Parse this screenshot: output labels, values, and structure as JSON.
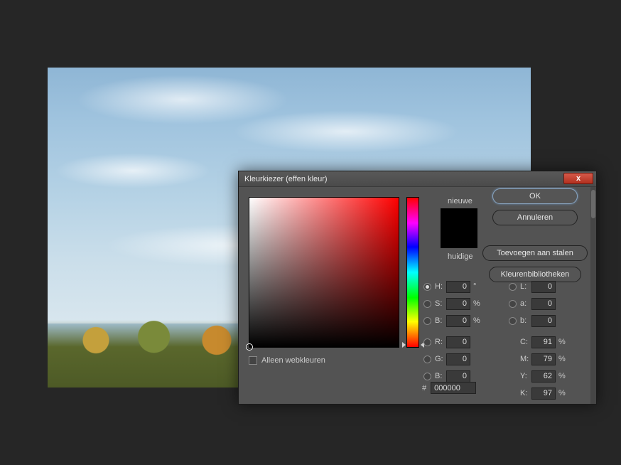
{
  "canvas": {
    "alt": "landscape-photo"
  },
  "dialog": {
    "title": "Kleurkiezer (effen kleur)",
    "close_icon": "x",
    "labels": {
      "new": "nieuwe",
      "current": "huidige",
      "web_only": "Alleen webkleuren",
      "hash": "#"
    },
    "buttons": {
      "ok": "OK",
      "cancel": "Annuleren",
      "add_swatch": "Toevoegen aan stalen",
      "libraries": "Kleurenbibliotheken"
    },
    "hsb": {
      "h_label": "H:",
      "h_value": "0",
      "h_unit": "°",
      "s_label": "S:",
      "s_value": "0",
      "s_unit": "%",
      "b_label": "B:",
      "b_value": "0",
      "b_unit": "%"
    },
    "rgb": {
      "r_label": "R:",
      "r_value": "0",
      "g_label": "G:",
      "g_value": "0",
      "b_label": "B:",
      "b_value": "0"
    },
    "lab": {
      "l_label": "L:",
      "l_value": "0",
      "a_label": "a:",
      "a_value": "0",
      "b_label": "b:",
      "b_value": "0"
    },
    "cmyk": {
      "c_label": "C:",
      "c_value": "91",
      "c_unit": "%",
      "m_label": "M:",
      "m_value": "79",
      "m_unit": "%",
      "y_label": "Y:",
      "y_value": "62",
      "y_unit": "%",
      "k_label": "K:",
      "k_value": "97",
      "k_unit": "%"
    },
    "hex": "000000",
    "swatch": {
      "new_color": "#000000",
      "current_color": "#000000"
    }
  }
}
